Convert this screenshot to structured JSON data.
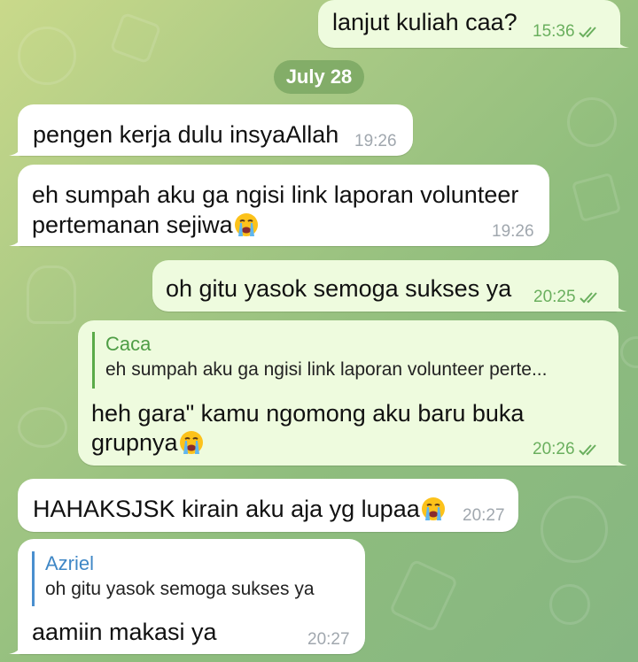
{
  "date_separator": "July 28",
  "messages": [
    {
      "text": "lanjut kuliah caa?",
      "time": "15:36"
    },
    {
      "text": "pengen kerja dulu insyaAllah",
      "time": "19:26"
    },
    {
      "line1": "eh sumpah aku ga ngisi link laporan volunteer",
      "line2": "pertemanan sejiwa",
      "emoji": "loudly-crying-face",
      "time": "19:26"
    },
    {
      "text": "oh gitu yasok semoga sukses ya",
      "time": "20:25"
    },
    {
      "reply_name": "Caca",
      "reply_text": "eh sumpah aku ga ngisi link laporan volunteer perte...",
      "line1": "heh gara\" kamu ngomong aku baru buka",
      "line2": "grupnya",
      "emoji": "loudly-crying-face",
      "time": "20:26"
    },
    {
      "text": "HAHAKSJSK kirain aku aja yg lupaa",
      "emoji": "loudly-crying-face",
      "time": "20:27"
    },
    {
      "reply_name": "Azriel",
      "reply_text": "oh gitu yasok semoga sukses ya",
      "text": "aamiin makasi ya",
      "time": "20:27"
    }
  ],
  "colors": {
    "incoming_bubble": "#ffffff",
    "outgoing_bubble": "#eefbde",
    "outgoing_time": "#6aaf5e",
    "incoming_time": "#a0a7ae",
    "reply_green": "#4e9d45",
    "reply_blue": "#3f87c6"
  }
}
